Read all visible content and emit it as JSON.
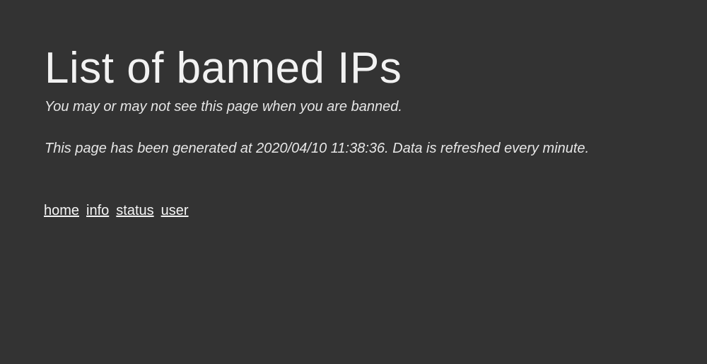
{
  "header": {
    "title": "List of banned IPs",
    "subtitle": "You may or may not see this page when you are banned.",
    "generated_info": "This page has been generated at 2020/04/10 11:38:36. Data is refreshed every minute."
  },
  "nav": {
    "links": [
      "home",
      "info",
      "status",
      "user"
    ]
  },
  "colors": {
    "background": "#333333",
    "text": "#eeeeee"
  }
}
